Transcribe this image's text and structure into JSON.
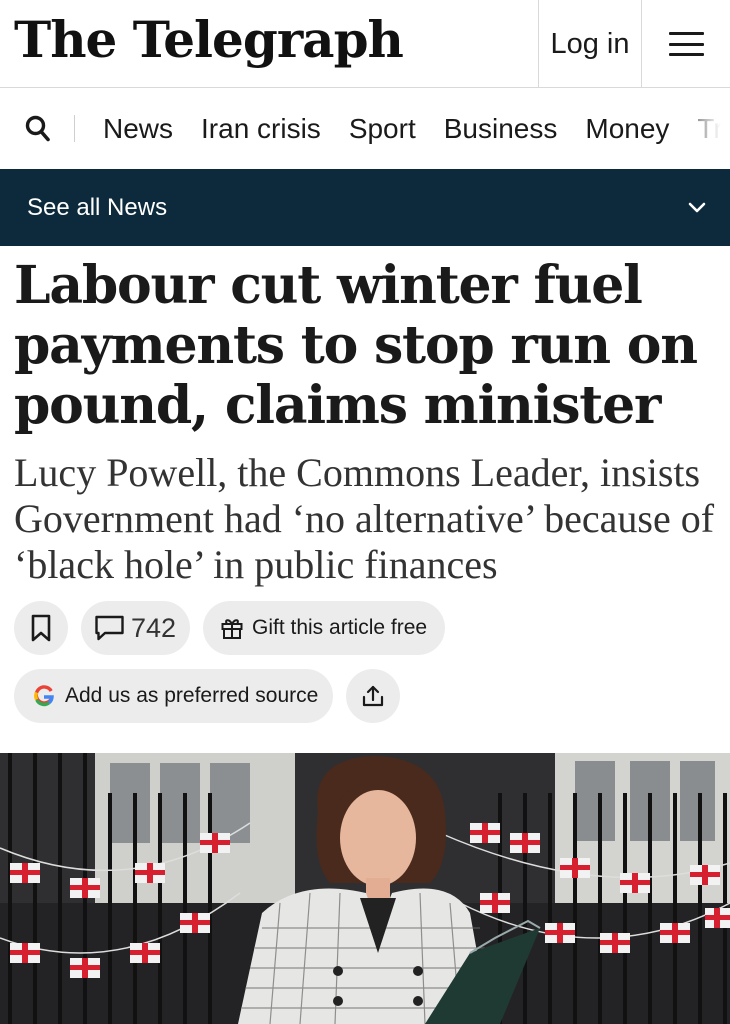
{
  "header": {
    "logo_text": "The Telegraph",
    "login_label": "Log in",
    "menu_icon": "hamburger-menu-icon"
  },
  "nav": {
    "search_icon": "search-icon",
    "items": [
      {
        "label": "News"
      },
      {
        "label": "Iran crisis"
      },
      {
        "label": "Sport"
      },
      {
        "label": "Business"
      },
      {
        "label": "Money"
      },
      {
        "label": "Tr"
      }
    ]
  },
  "section_bar": {
    "label": "See all News",
    "icon": "chevron-down-icon"
  },
  "article": {
    "headline": "Labour cut winter fuel payments to stop run on pound, claims minister",
    "standfirst": "Lucy Powell, the Commons Leader, insists Government had ‘no alternative’ because of ‘black hole’ in public finances",
    "actions": {
      "bookmark_icon": "bookmark-icon",
      "comments_icon": "comment-icon",
      "comment_count": "742",
      "gift_icon": "gift-icon",
      "gift_label": "Gift this article free",
      "google_icon": "google-icon",
      "preferred_label": "Add us as preferred source",
      "share_icon": "share-icon"
    }
  },
  "colors": {
    "section_bar_bg": "#0d2a3d",
    "pill_bg": "#ececec",
    "text": "#1a1a1a"
  }
}
